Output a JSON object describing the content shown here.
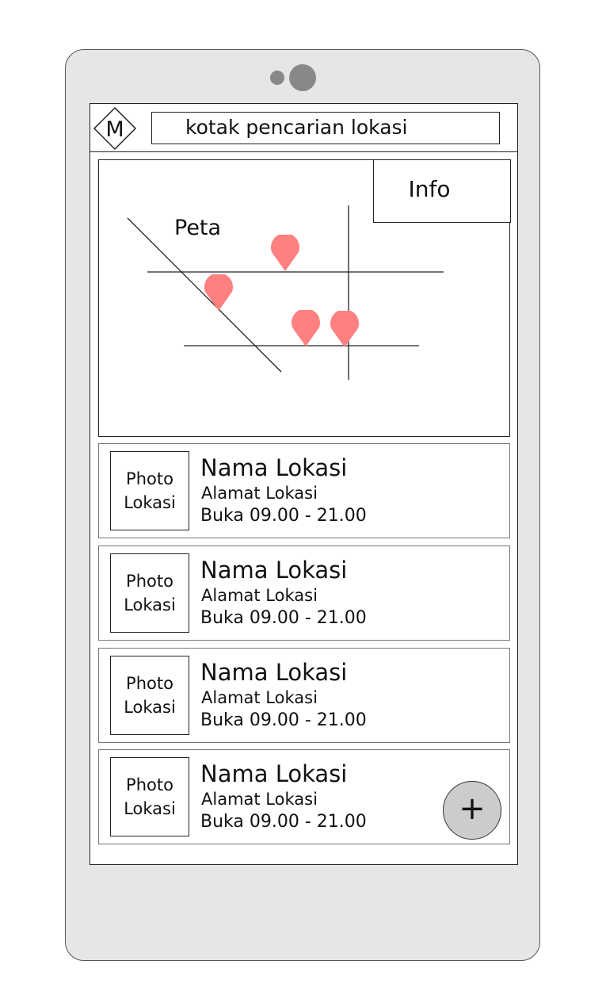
{
  "header": {
    "logo_letter": "M",
    "search_text": "kotak pencarian lokasi"
  },
  "map": {
    "label": "Peta",
    "info_label": "Info",
    "pin_color": "#ff8080"
  },
  "list": [
    {
      "photo_line1": "Photo",
      "photo_line2": "Lokasi",
      "name": "Nama Lokasi",
      "address": "Alamat Lokasi",
      "hours": "Buka 09.00 - 21.00"
    },
    {
      "photo_line1": "Photo",
      "photo_line2": "Lokasi",
      "name": "Nama Lokasi",
      "address": "Alamat Lokasi",
      "hours": "Buka 09.00 - 21.00"
    },
    {
      "photo_line1": "Photo",
      "photo_line2": "Lokasi",
      "name": "Nama Lokasi",
      "address": "Alamat Lokasi",
      "hours": "Buka 09.00 - 21.00"
    },
    {
      "photo_line1": "Photo",
      "photo_line2": "Lokasi",
      "name": "Nama Lokasi",
      "address": "Alamat Lokasi",
      "hours": "Buka 09.00 - 21.00"
    }
  ],
  "fab": {
    "icon": "plus-icon",
    "label": "+"
  }
}
